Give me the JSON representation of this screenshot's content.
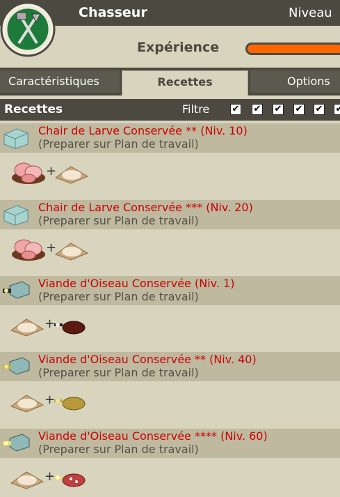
{
  "header": {
    "job_name": "Chasseur",
    "level_label": "Niveau",
    "experience_label": "Expérience",
    "experience_progress": 0.95,
    "accent_color": "#ff6600"
  },
  "tabs": [
    {
      "label": "Caractéristiques",
      "active": false
    },
    {
      "label": "Recettes",
      "active": true
    },
    {
      "label": "Options",
      "active": false
    }
  ],
  "recipes_section": {
    "title": "Recettes",
    "filter_label": "Filtre",
    "filters_checked": [
      true,
      true,
      true,
      true,
      true,
      true
    ],
    "checkmark": "✔"
  },
  "recipes": [
    {
      "name": "Chair de Larve Conservée ** (Niv. 10)",
      "sub": "(Preparer sur Plan de travail)",
      "result_icon": "box-icon",
      "ingredients": [
        "larva-meat-icon",
        "salt-icon"
      ],
      "plus": "+"
    },
    {
      "name": "Chair de Larve Conservée *** (Niv. 20)",
      "sub": "(Preparer sur Plan de travail)",
      "result_icon": "box-icon",
      "ingredients": [
        "larva-meat-icon",
        "salt-icon"
      ],
      "plus": "+"
    },
    {
      "name": "Viande d'Oiseau Conservée (Niv. 1)",
      "sub": "(Preparer sur Plan de travail)",
      "result_icon": "bird-meat-box-icon",
      "ingredients": [
        "salt-icon",
        "bird-meat-icon"
      ],
      "plus": "+"
    },
    {
      "name": "Viande d'Oiseau Conservée ** (Niv. 40)",
      "sub": "(Preparer sur Plan de travail)",
      "result_icon": "bird-meat-box-icon",
      "ingredients": [
        "salt-icon",
        "bird-meat-icon"
      ],
      "plus": "+"
    },
    {
      "name": "Viande d'Oiseau Conservée **** (Niv. 60)",
      "sub": "(Preparer sur Plan de travail)",
      "result_icon": "bird-meat-box-icon",
      "ingredients": [
        "salt-icon",
        "bird-meat-icon"
      ],
      "plus": "+"
    }
  ]
}
